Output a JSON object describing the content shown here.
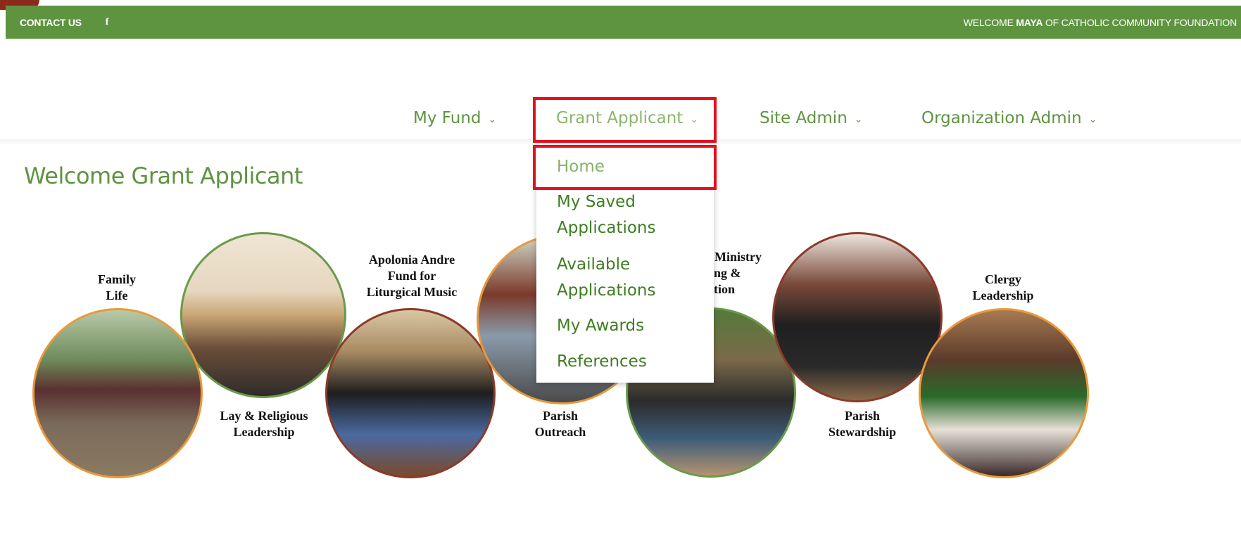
{
  "topbar": {
    "contact": "CONTACT US",
    "facebook": "f",
    "welcome_prefix": "WELCOME ",
    "welcome_user": "MAYA",
    "welcome_suffix": " OF CATHOLIC COMMUNITY FOUNDATION"
  },
  "nav": {
    "my_fund": "My Fund",
    "grant_applicant": "Grant Applicant",
    "site_admin": "Site Admin",
    "organization_admin": "Organization Admin",
    "chevron": "⌄"
  },
  "dropdown": {
    "home": "Home",
    "my_saved_1": "My Saved",
    "my_saved_2": "Applications",
    "available_1": "Available",
    "available_2": "Applications",
    "my_awards": "My Awards",
    "references": "References"
  },
  "page": {
    "title": "Welcome Grant Applicant"
  },
  "programs": {
    "family_1": "Family",
    "family_2": "Life",
    "lay_1": "Lay & Religious",
    "lay_2": "Leadership",
    "apolonia_1": "Apolonia Andre",
    "apolonia_2": "Fund for",
    "apolonia_3": "Liturgical Music",
    "outreach_1": "Parish",
    "outreach_2": "Outreach",
    "ministry_1": "Ministry",
    "ministry_2": "ing &",
    "ministry_3": "ation",
    "stewardship_1": "Parish",
    "stewardship_2": "Stewardship",
    "clergy_1": "Clergy",
    "clergy_2": "Leadership"
  },
  "colors": {
    "brand_green": "#5e9440",
    "dropdown_green": "#3f7d22",
    "highlight_red": "#e5101d",
    "circle_border_orange": "#e89a3c",
    "circle_border_green": "#6a9a4a",
    "circle_border_brown": "#8b3a2a"
  },
  "icons": {
    "facebook": "facebook-icon",
    "chevron": "chevron-down-icon"
  }
}
